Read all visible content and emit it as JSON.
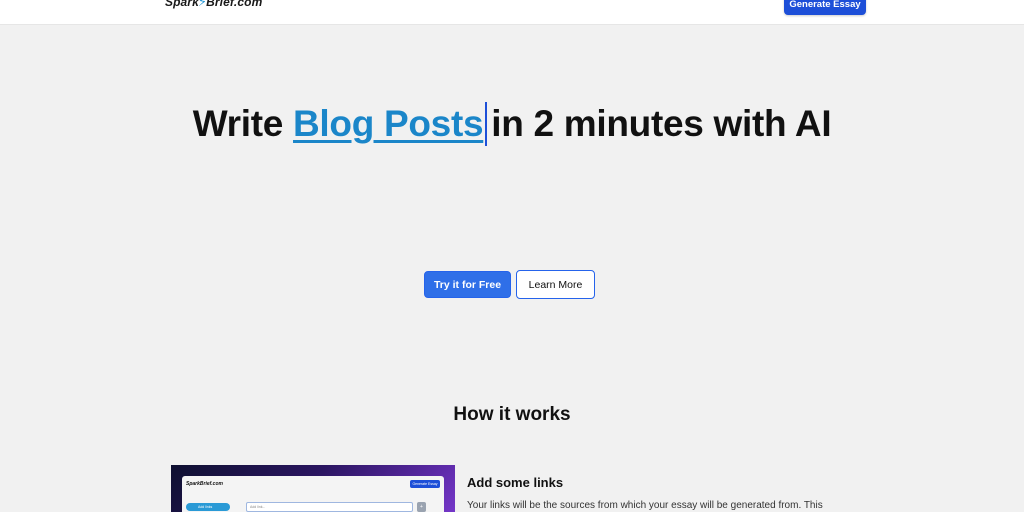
{
  "header": {
    "logo": {
      "prefix": "Spark",
      "suffix": "Brief.com"
    },
    "cta_label": "Generate Essay"
  },
  "hero": {
    "title_before": "Write",
    "title_highlight": "Blog Posts",
    "title_after": "in 2 minutes with AI",
    "primary_button": "Try it for Free",
    "secondary_button": "Learn More"
  },
  "how_it_works": {
    "title": "How it works",
    "preview": {
      "logo": "SparkBrief.com",
      "cta_label": "Generate Essay",
      "side_button": "Add links",
      "input_placeholder": "Add link..."
    },
    "step": {
      "title": "Add some links",
      "description": "Your links will be the sources from which your essay will be generated from. This"
    }
  },
  "colors": {
    "primary": "#1d4fd8",
    "highlight": "#1b86c9",
    "background": "#f1f1f1"
  }
}
